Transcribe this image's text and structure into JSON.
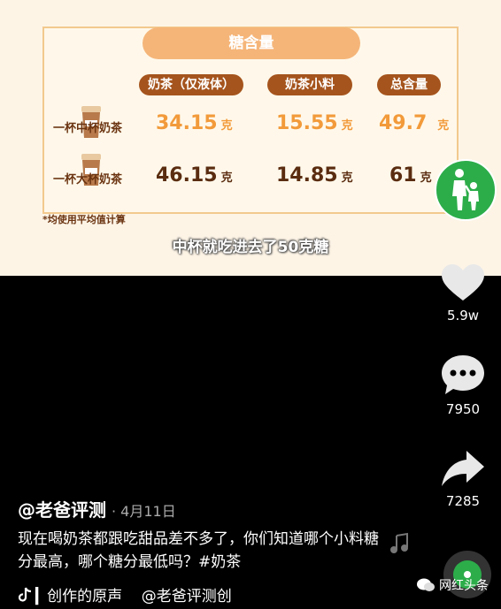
{
  "table": {
    "title": "糖含量",
    "columns": [
      "奶茶（仅液体）",
      "奶茶小料",
      "总含量"
    ],
    "rows": [
      {
        "label": "一杯中杯奶茶",
        "values": [
          "34.15",
          "15.55",
          "49.7"
        ],
        "unit": "克"
      },
      {
        "label": "一杯大杯奶茶",
        "values": [
          "46.15",
          "14.85",
          "61"
        ],
        "unit": "克"
      }
    ],
    "note": "*均使用平均值计算"
  },
  "subtitle": "中杯就吃进去了50克糖",
  "actions": {
    "like_count": "5.9w",
    "comment_count": "7950",
    "share_count": "7285"
  },
  "post": {
    "author": "@老爸评测",
    "date": "· 4月11日",
    "description": "现在喝奶茶都跟吃甜品差不多了，你们知道哪个小料糖分最高，哪个糖分最低吗？#奶茶",
    "music": "▎创作的原声    @老爸评测创"
  },
  "watermark": "网红头条",
  "colors": {
    "accent_orange": "#f29a3a",
    "header_brown": "#a5541d",
    "avatar_green": "#2cad4a"
  }
}
